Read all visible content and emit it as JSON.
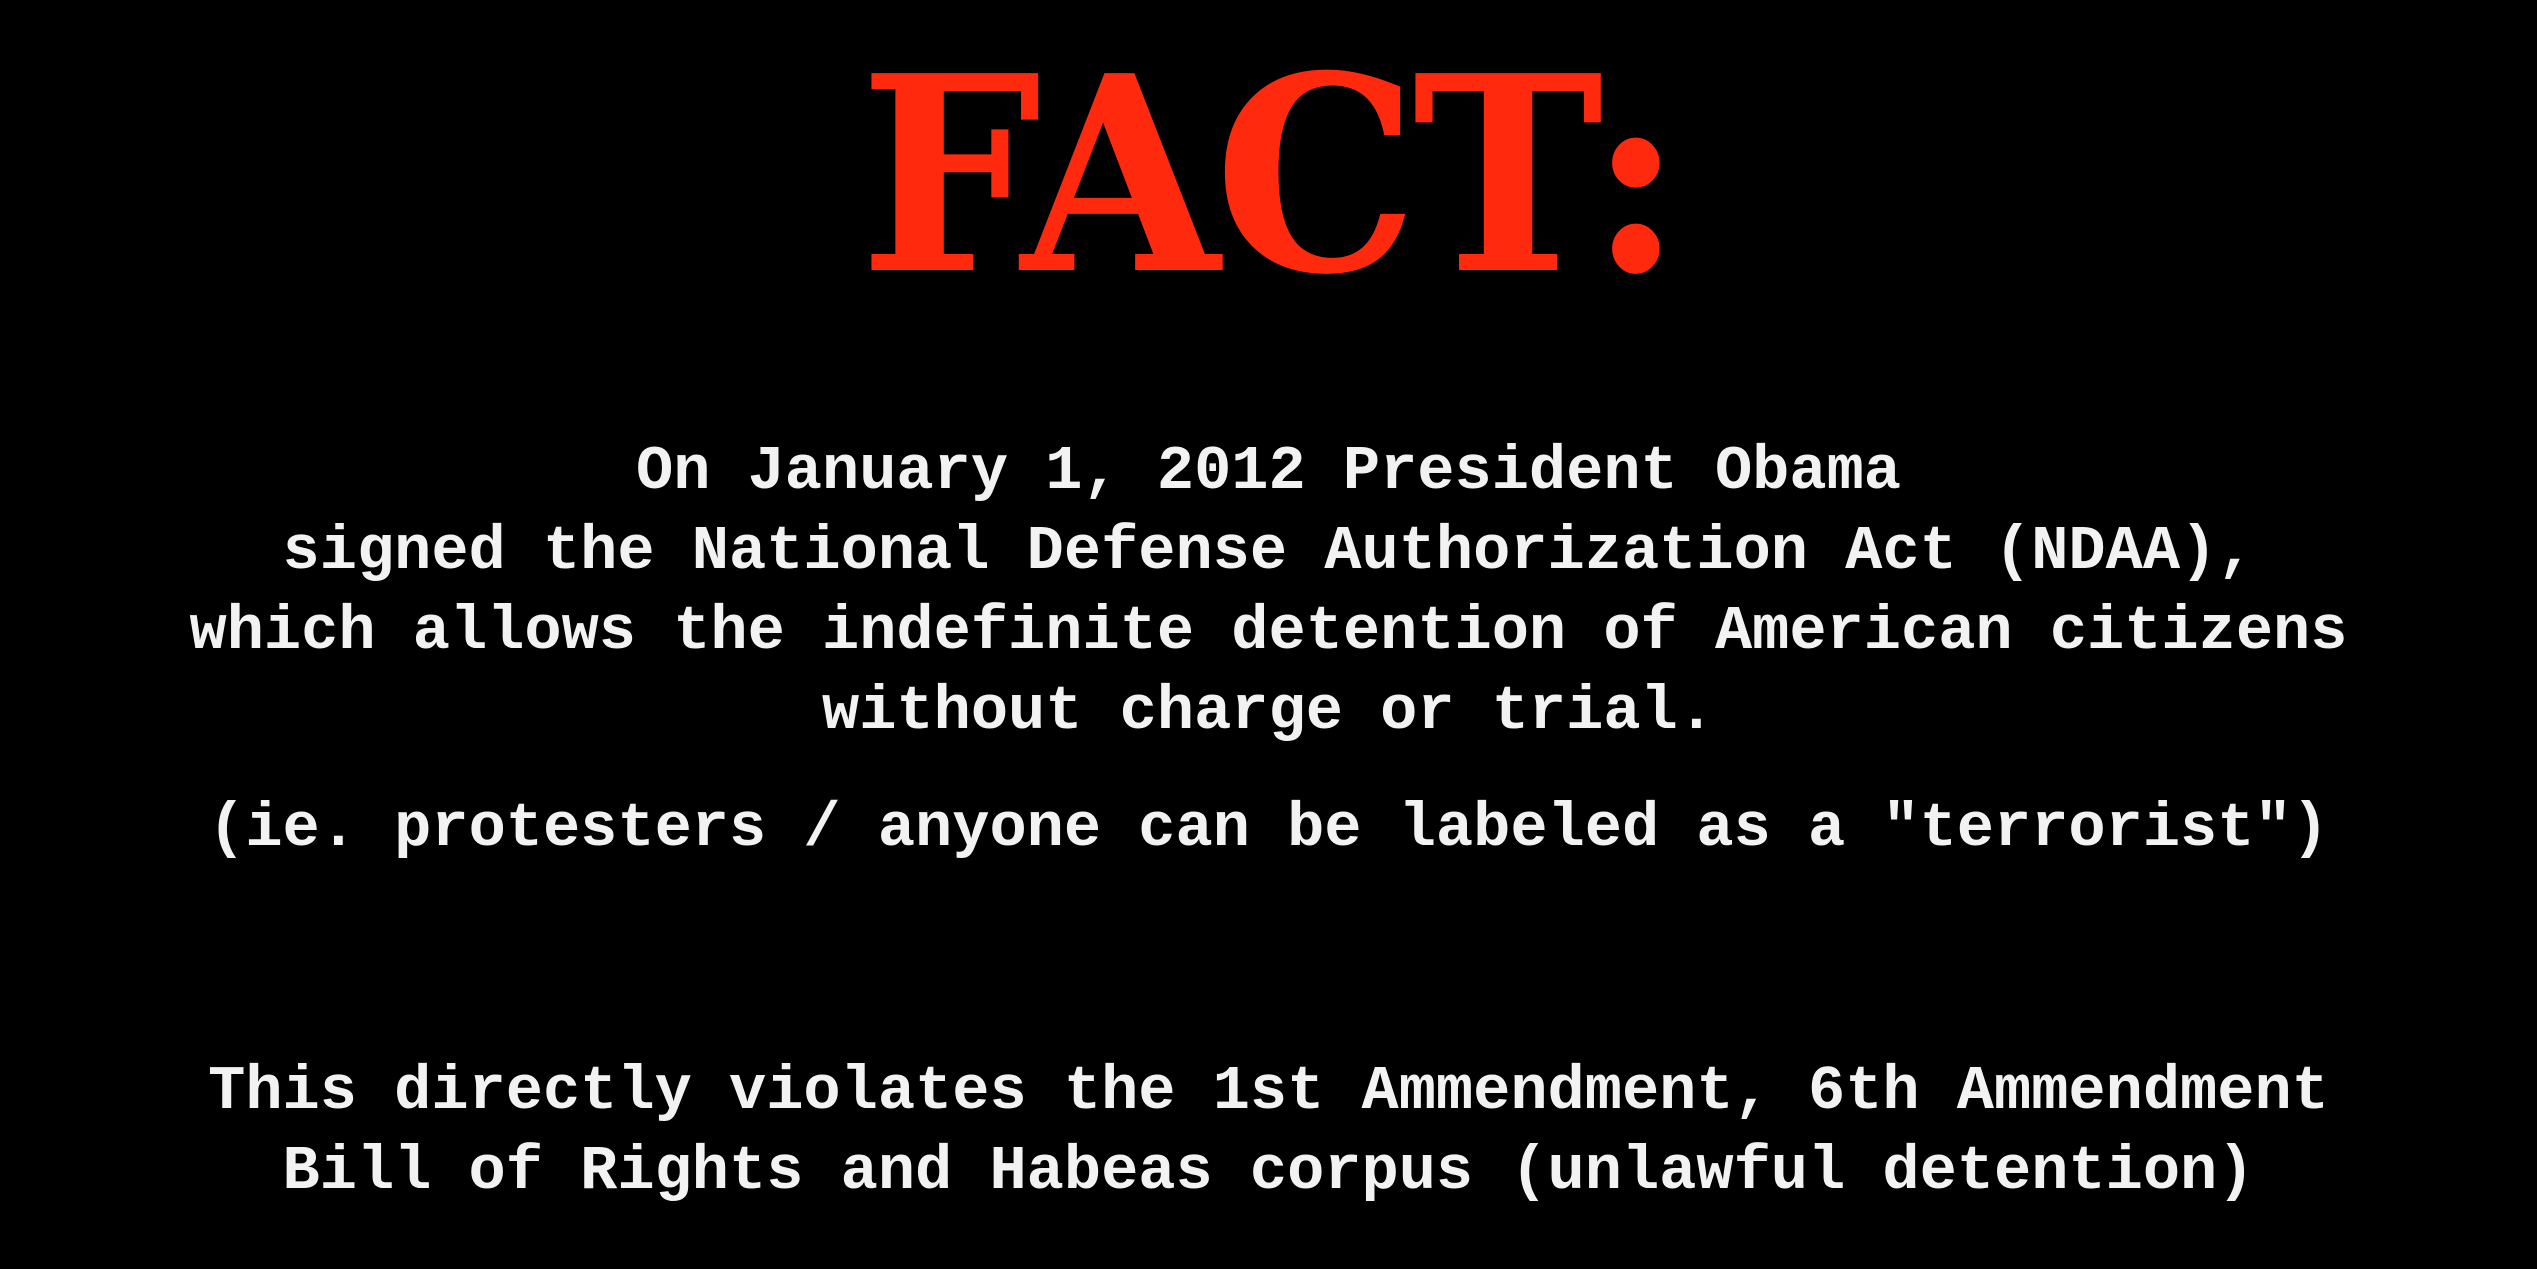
{
  "slide": {
    "headline": "FACT:",
    "headline_color": "#ff2a0d",
    "text_color": "#f2f2f2",
    "background_color": "#000000",
    "statement_lines": [
      "On January 1, 2012 President Obama",
      "signed the National Defense Authorization Act (NDAA),",
      "which allows the indefinite detention of American citizens",
      "without charge or trial."
    ],
    "note": "(ie. protesters / anyone can be labeled as a \"terrorist\")",
    "violation_lines": [
      "This directly violates the 1st Ammendment, 6th Ammendment",
      "Bill of Rights and Habeas corpus (unlawful detention)"
    ]
  }
}
